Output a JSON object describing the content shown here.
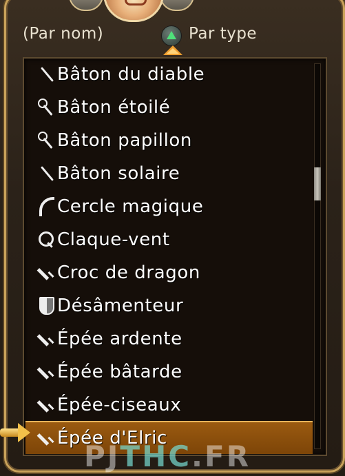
{
  "sort": {
    "by_name_label": "(Par nom)",
    "by_type_label": "Par type",
    "toggle_button": "triangle-button-icon"
  },
  "items": [
    {
      "label": "Bâton du diable",
      "icon": "rod-icon"
    },
    {
      "label": "Bâton étoilé",
      "icon": "star-staff-icon"
    },
    {
      "label": "Bâton papillon",
      "icon": "butterfly-staff-icon"
    },
    {
      "label": "Bâton solaire",
      "icon": "rod-icon"
    },
    {
      "label": "Cercle magique",
      "icon": "crescent-blade-icon"
    },
    {
      "label": "Claque-vent",
      "icon": "ring-weapon-icon"
    },
    {
      "label": "Croc de dragon",
      "icon": "sword-icon"
    },
    {
      "label": "Désâmenteur",
      "icon": "shield-icon"
    },
    {
      "label": "Épée ardente",
      "icon": "sword-icon"
    },
    {
      "label": "Épée bâtarde",
      "icon": "sword-icon"
    },
    {
      "label": "Épée-ciseaux",
      "icon": "sword-icon"
    },
    {
      "label": "Épée d'Elric",
      "icon": "sword-icon",
      "selected": true
    }
  ],
  "watermark": {
    "part1": "PJ",
    "part2": "THC",
    "part3": ".FR"
  },
  "colors": {
    "frame_gold": "#c9a25a",
    "selection": "#9a5a10",
    "panel_bg": "#150e09",
    "accent_triangle": "#4fe07a"
  }
}
